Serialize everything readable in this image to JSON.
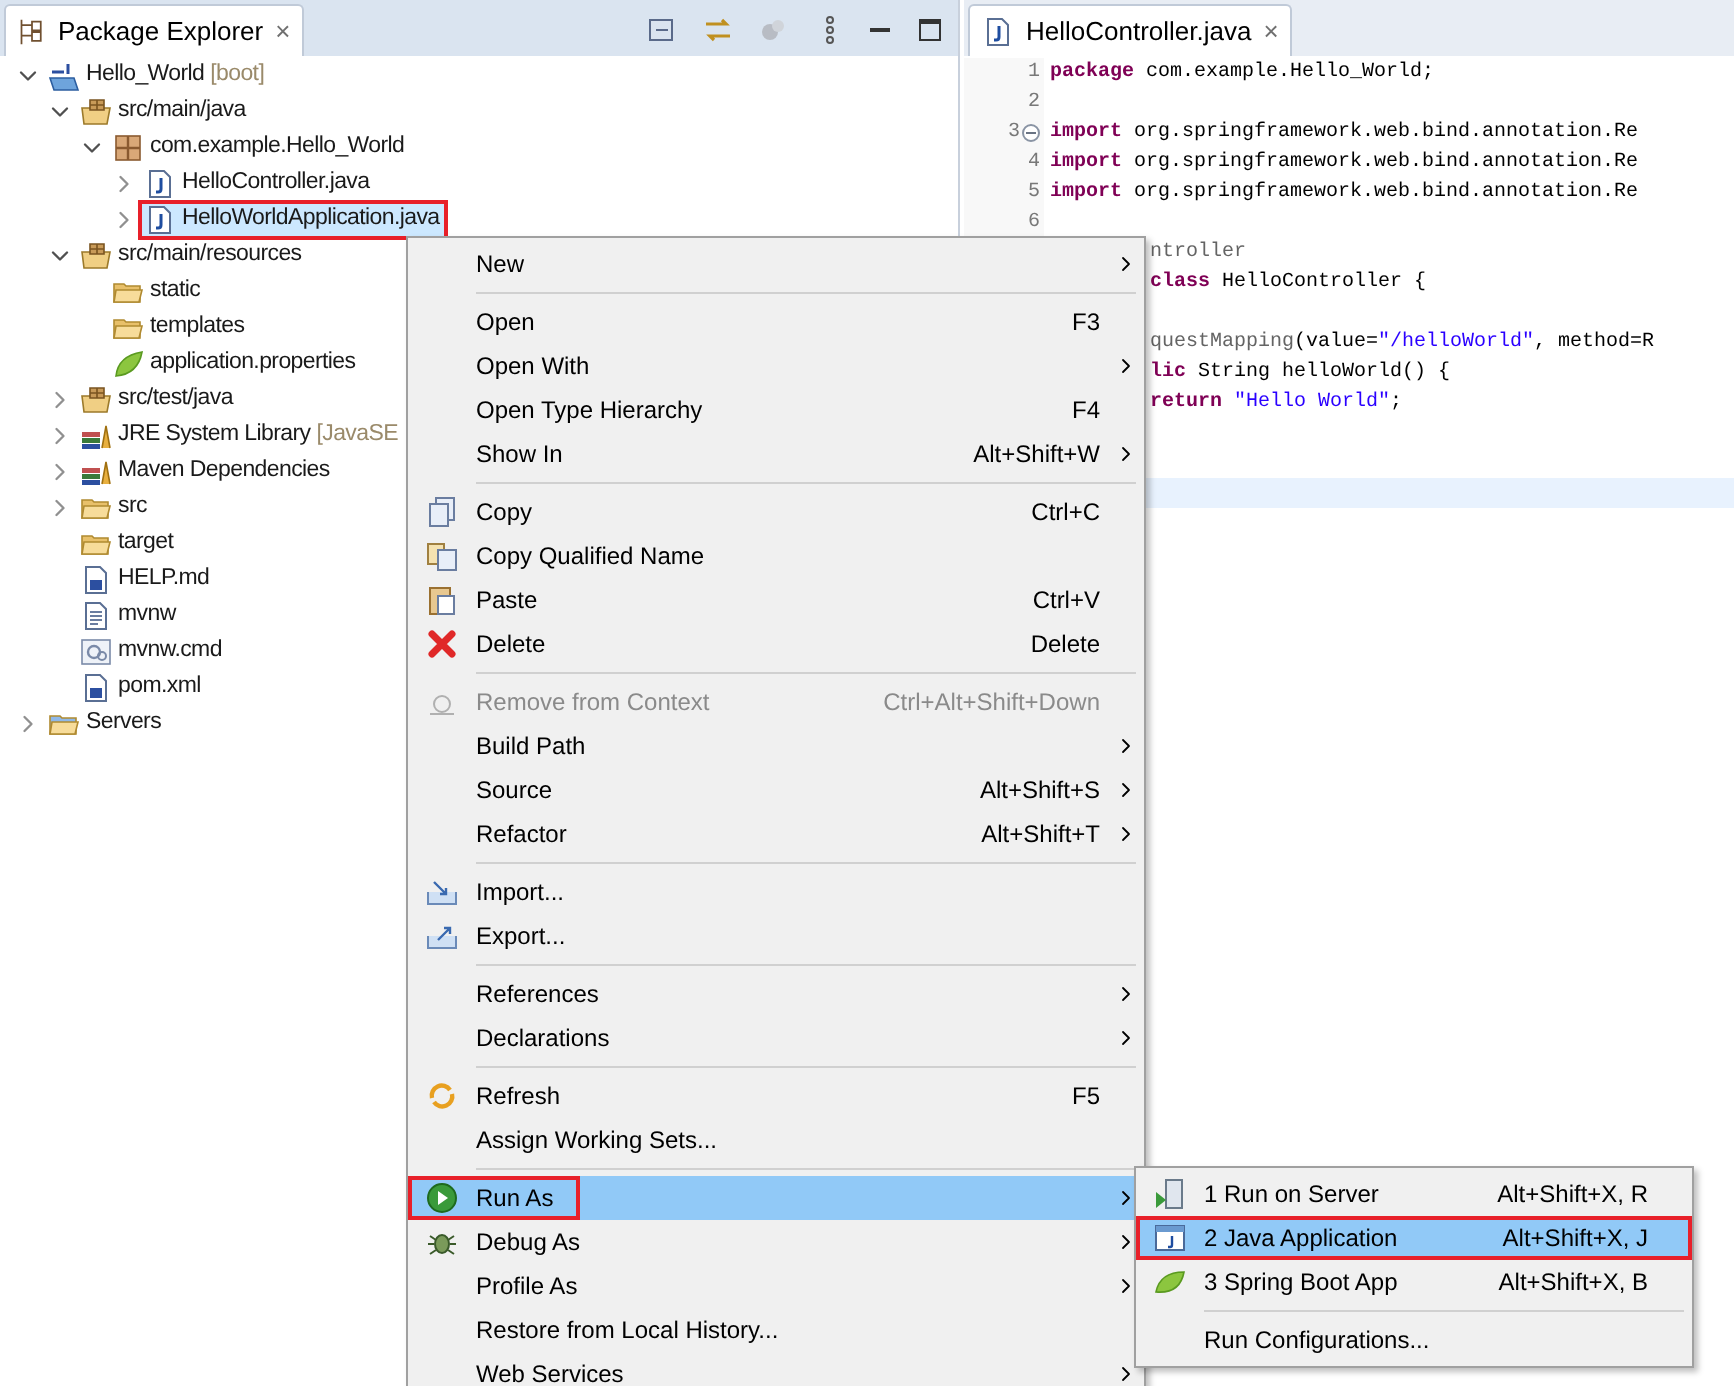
{
  "explorer": {
    "tab": {
      "label": "Package Explorer",
      "close": "×"
    },
    "tree": [
      {
        "label": "Hello_World",
        "decoration": "[boot]",
        "kind": "project",
        "expanded": true,
        "selected": false,
        "annotated": false,
        "children": [
          {
            "label": "src/main/java",
            "kind": "source-folder",
            "expanded": true,
            "selected": false,
            "annotated": false,
            "children": [
              {
                "label": "com.example.Hello_World",
                "kind": "package",
                "expanded": true,
                "selected": false,
                "annotated": false,
                "children": [
                  {
                    "label": "HelloController.java",
                    "kind": "java-file",
                    "expanded": false,
                    "selected": false,
                    "annotated": false
                  },
                  {
                    "label": "HelloWorldApplication.java",
                    "kind": "java-file",
                    "expanded": false,
                    "selected": true,
                    "annotated": true
                  }
                ]
              }
            ]
          },
          {
            "label": "src/main/resources",
            "kind": "source-folder",
            "expanded": true,
            "selected": false,
            "annotated": false,
            "children": [
              {
                "label": "static",
                "kind": "folder",
                "selected": false,
                "annotated": false
              },
              {
                "label": "templates",
                "kind": "folder",
                "selected": false,
                "annotated": false
              },
              {
                "label": "application.properties",
                "kind": "leaf-file",
                "selected": false,
                "annotated": false
              }
            ]
          },
          {
            "label": "src/test/java",
            "kind": "source-folder",
            "expanded": false,
            "selected": false,
            "annotated": false
          },
          {
            "label": "JRE System Library",
            "decoration": "[JavaSE",
            "kind": "library",
            "expanded": false,
            "selected": false,
            "annotated": false
          },
          {
            "label": "Maven Dependencies",
            "kind": "library",
            "expanded": false,
            "selected": false,
            "annotated": false
          },
          {
            "label": "src",
            "kind": "folder",
            "expanded": false,
            "selected": false,
            "annotated": false
          },
          {
            "label": "target",
            "kind": "folder",
            "selected": false,
            "annotated": false
          },
          {
            "label": "HELP.md",
            "kind": "doc-file",
            "selected": false,
            "annotated": false
          },
          {
            "label": "mvnw",
            "kind": "text-file",
            "selected": false,
            "annotated": false
          },
          {
            "label": "mvnw.cmd",
            "kind": "cmd-file",
            "selected": false,
            "annotated": false
          },
          {
            "label": "pom.xml",
            "kind": "maven-file",
            "selected": false,
            "annotated": false
          }
        ]
      },
      {
        "label": "Servers",
        "kind": "server-folder",
        "expanded": false,
        "selected": false,
        "annotated": false
      }
    ]
  },
  "editor": {
    "tab": {
      "label": "HelloController.java",
      "close": "×"
    },
    "lines": [
      {
        "kind": "code",
        "number": "1",
        "segments": [
          {
            "text": "package",
            "kind": "keyword"
          },
          {
            "text": " com.example.Hello_World;",
            "kind": "plain"
          }
        ]
      },
      {
        "kind": "blank",
        "number": "2"
      },
      {
        "kind": "code",
        "number": "3",
        "folded": false,
        "segments": [
          {
            "text": "import",
            "kind": "keyword"
          },
          {
            "text": " org.springframework.web.bind.annotation.Re",
            "kind": "plain"
          }
        ]
      },
      {
        "kind": "code",
        "number": "4",
        "segments": [
          {
            "text": "import",
            "kind": "keyword"
          },
          {
            "text": " org.springframework.web.bind.annotation.Re",
            "kind": "plain"
          }
        ]
      },
      {
        "kind": "code",
        "number": "5",
        "segments": [
          {
            "text": "import",
            "kind": "keyword"
          },
          {
            "text": " org.springframework.web.bind.annotation.Re",
            "kind": "plain"
          }
        ]
      },
      {
        "kind": "blank",
        "number": "6"
      },
      {
        "kind": "code",
        "partial": true,
        "segments": [
          {
            "text": "ntroller",
            "kind": "annotation"
          }
        ]
      },
      {
        "kind": "code",
        "partial": true,
        "segments": [
          {
            "text": "class",
            "kind": "keyword"
          },
          {
            "text": " HelloController {",
            "kind": "plain"
          }
        ]
      },
      {
        "kind": "blank"
      },
      {
        "kind": "code",
        "partial": true,
        "segments": [
          {
            "text": "questMapping",
            "kind": "annotation"
          },
          {
            "text": "(value=",
            "kind": "plain"
          },
          {
            "text": "\"/helloWorld\"",
            "kind": "string"
          },
          {
            "text": ", method=R",
            "kind": "plain"
          }
        ]
      },
      {
        "kind": "code",
        "partial": true,
        "segments": [
          {
            "text": "lic",
            "kind": "keyword"
          },
          {
            "text": " String helloWorld() {",
            "kind": "plain"
          }
        ]
      },
      {
        "kind": "code",
        "partial": true,
        "segments": [
          {
            "text": "return ",
            "kind": "keyword"
          },
          {
            "text": "\"Hello World\"",
            "kind": "string"
          },
          {
            "text": ";",
            "kind": "plain"
          }
        ]
      },
      {
        "kind": "blank"
      },
      {
        "kind": "blank"
      },
      {
        "kind": "blank",
        "current": true
      }
    ]
  },
  "context_menu": {
    "items": [
      {
        "kind": "item",
        "label": "New",
        "submenu": true,
        "disabled": false,
        "selected": false,
        "annotated": false
      },
      {
        "kind": "separator"
      },
      {
        "kind": "item",
        "label": "Open",
        "shortcut": "F3",
        "disabled": false,
        "selected": false,
        "annotated": false
      },
      {
        "kind": "item",
        "label": "Open With",
        "submenu": true,
        "disabled": false,
        "selected": false,
        "annotated": false
      },
      {
        "kind": "item",
        "label": "Open Type Hierarchy",
        "shortcut": "F4",
        "disabled": false,
        "selected": false,
        "annotated": false
      },
      {
        "kind": "item",
        "label": "Show In",
        "shortcut": "Alt+Shift+W",
        "submenu": true,
        "disabled": false,
        "selected": false,
        "annotated": false
      },
      {
        "kind": "separator"
      },
      {
        "kind": "item",
        "label": "Copy",
        "shortcut": "Ctrl+C",
        "disabled": false,
        "selected": false,
        "annotated": false
      },
      {
        "kind": "item",
        "label": "Copy Qualified Name",
        "disabled": false,
        "selected": false,
        "annotated": false
      },
      {
        "kind": "item",
        "label": "Paste",
        "shortcut": "Ctrl+V",
        "disabled": false,
        "selected": false,
        "annotated": false
      },
      {
        "kind": "item",
        "label": "Delete",
        "shortcut": "Delete",
        "disabled": false,
        "selected": false,
        "annotated": false
      },
      {
        "kind": "separator"
      },
      {
        "kind": "item",
        "label": "Remove from Context",
        "shortcut": "Ctrl+Alt+Shift+Down",
        "disabled": true,
        "selected": false,
        "annotated": false
      },
      {
        "kind": "item",
        "label": "Build Path",
        "submenu": true,
        "disabled": false,
        "selected": false,
        "annotated": false
      },
      {
        "kind": "item",
        "label": "Source",
        "shortcut": "Alt+Shift+S",
        "submenu": true,
        "disabled": false,
        "selected": false,
        "annotated": false
      },
      {
        "kind": "item",
        "label": "Refactor",
        "shortcut": "Alt+Shift+T",
        "submenu": true,
        "disabled": false,
        "selected": false,
        "annotated": false
      },
      {
        "kind": "separator"
      },
      {
        "kind": "item",
        "label": "Import...",
        "disabled": false,
        "selected": false,
        "annotated": false
      },
      {
        "kind": "item",
        "label": "Export...",
        "disabled": false,
        "selected": false,
        "annotated": false
      },
      {
        "kind": "separator"
      },
      {
        "kind": "item",
        "label": "References",
        "submenu": true,
        "disabled": false,
        "selected": false,
        "annotated": false
      },
      {
        "kind": "item",
        "label": "Declarations",
        "submenu": true,
        "disabled": false,
        "selected": false,
        "annotated": false
      },
      {
        "kind": "separator"
      },
      {
        "kind": "item",
        "label": "Refresh",
        "shortcut": "F5",
        "disabled": false,
        "selected": false,
        "annotated": false
      },
      {
        "kind": "item",
        "label": "Assign Working Sets...",
        "disabled": false,
        "selected": false,
        "annotated": false
      },
      {
        "kind": "separator"
      },
      {
        "kind": "item",
        "label": "Run As",
        "submenu": true,
        "disabled": false,
        "selected": true,
        "annotated": true
      },
      {
        "kind": "item",
        "label": "Debug As",
        "submenu": true,
        "disabled": false,
        "selected": false,
        "annotated": false
      },
      {
        "kind": "item",
        "label": "Profile As",
        "submenu": true,
        "disabled": false,
        "selected": false,
        "annotated": false
      },
      {
        "kind": "item",
        "label": "Restore from Local History...",
        "disabled": false,
        "selected": false,
        "annotated": false
      },
      {
        "kind": "item",
        "label": "Web Services",
        "submenu": true,
        "disabled": false,
        "selected": false,
        "annotated": false
      }
    ]
  },
  "run_as_menu": {
    "items": [
      {
        "kind": "item",
        "label": "1 Run on Server",
        "shortcut": "Alt+Shift+X, R",
        "selected": false,
        "annotated": false
      },
      {
        "kind": "item",
        "label": "2 Java Application",
        "shortcut": "Alt+Shift+X, J",
        "selected": true,
        "annotated": true
      },
      {
        "kind": "item",
        "label": "3 Spring Boot App",
        "shortcut": "Alt+Shift+X, B",
        "selected": false,
        "annotated": false
      },
      {
        "kind": "separator"
      },
      {
        "kind": "item",
        "label": "Run Configurations...",
        "selected": false,
        "annotated": false
      }
    ]
  }
}
